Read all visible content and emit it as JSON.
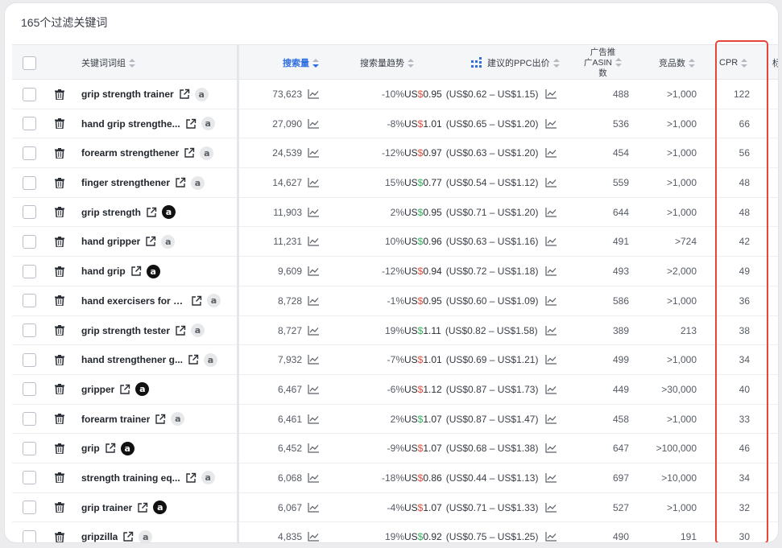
{
  "header": {
    "title": "165个过滤关键词"
  },
  "columns": {
    "keyword_group": "关键词词组",
    "search_volume": "搜索量",
    "search_trend": "搜索量趋势",
    "ppc_bid": "建议的PPC出价",
    "ad_asin_l1": "广告推",
    "ad_asin_l2": "广ASIN",
    "ad_asin_l3": "数",
    "competitors": "竞品数",
    "cpr": "CPR",
    "extra": "标"
  },
  "colors": {
    "accent": "#2f6fe0",
    "highlight": "#e8453a"
  },
  "rows": [
    {
      "keyword": "grip strength trainer",
      "volume": "73,623",
      "trend": "-10%",
      "bid": "US$0.95",
      "range": "(US$0.62 – US$1.15)",
      "asin": "488",
      "comp": ">1,000",
      "cpr": "122",
      "amz": "light",
      "dollar": "red"
    },
    {
      "keyword": "hand grip strengthe...",
      "volume": "27,090",
      "trend": "-8%",
      "bid": "US$1.01",
      "range": "(US$0.65 – US$1.20)",
      "asin": "536",
      "comp": ">1,000",
      "cpr": "66",
      "amz": "light",
      "dollar": "red"
    },
    {
      "keyword": "forearm strengthener",
      "volume": "24,539",
      "trend": "-12%",
      "bid": "US$0.97",
      "range": "(US$0.63 – US$1.20)",
      "asin": "454",
      "comp": ">1,000",
      "cpr": "56",
      "amz": "light",
      "dollar": "red"
    },
    {
      "keyword": "finger strengthener",
      "volume": "14,627",
      "trend": "15%",
      "bid": "US$0.77",
      "range": "(US$0.54 – US$1.12)",
      "asin": "559",
      "comp": ">1,000",
      "cpr": "48",
      "amz": "light",
      "dollar": "green"
    },
    {
      "keyword": "grip strength",
      "volume": "11,903",
      "trend": "2%",
      "bid": "US$0.95",
      "range": "(US$0.71 – US$1.20)",
      "asin": "644",
      "comp": ">1,000",
      "cpr": "48",
      "amz": "dark",
      "dollar": "green"
    },
    {
      "keyword": "hand gripper",
      "volume": "11,231",
      "trend": "10%",
      "bid": "US$0.96",
      "range": "(US$0.63 – US$1.16)",
      "asin": "491",
      "comp": ">724",
      "cpr": "42",
      "amz": "light",
      "dollar": "green"
    },
    {
      "keyword": "hand grip",
      "volume": "9,609",
      "trend": "-12%",
      "bid": "US$0.94",
      "range": "(US$0.72 – US$1.18)",
      "asin": "493",
      "comp": ">2,000",
      "cpr": "49",
      "amz": "dark",
      "dollar": "red"
    },
    {
      "keyword": "hand exercisers for s...",
      "volume": "8,728",
      "trend": "-1%",
      "bid": "US$0.95",
      "range": "(US$0.60 – US$1.09)",
      "asin": "586",
      "comp": ">1,000",
      "cpr": "36",
      "amz": "light",
      "dollar": "red"
    },
    {
      "keyword": "grip strength tester",
      "volume": "8,727",
      "trend": "19%",
      "bid": "US$1.11",
      "range": "(US$0.82 – US$1.58)",
      "asin": "389",
      "comp": "213",
      "cpr": "38",
      "amz": "light",
      "dollar": "green"
    },
    {
      "keyword": "hand strengthener g...",
      "volume": "7,932",
      "trend": "-7%",
      "bid": "US$1.01",
      "range": "(US$0.69 – US$1.21)",
      "asin": "499",
      "comp": ">1,000",
      "cpr": "34",
      "amz": "light",
      "dollar": "red"
    },
    {
      "keyword": "gripper",
      "volume": "6,467",
      "trend": "-6%",
      "bid": "US$1.12",
      "range": "(US$0.87 – US$1.73)",
      "asin": "449",
      "comp": ">30,000",
      "cpr": "40",
      "amz": "dark",
      "dollar": "red"
    },
    {
      "keyword": "forearm trainer",
      "volume": "6,461",
      "trend": "2%",
      "bid": "US$1.07",
      "range": "(US$0.87 – US$1.47)",
      "asin": "458",
      "comp": ">1,000",
      "cpr": "33",
      "amz": "light",
      "dollar": "green"
    },
    {
      "keyword": "grip",
      "volume": "6,452",
      "trend": "-9%",
      "bid": "US$1.07",
      "range": "(US$0.68 – US$1.38)",
      "asin": "647",
      "comp": ">100,000",
      "cpr": "46",
      "amz": "dark",
      "dollar": "red"
    },
    {
      "keyword": "strength training eq...",
      "volume": "6,068",
      "trend": "-18%",
      "bid": "US$0.86",
      "range": "(US$0.44 – US$1.13)",
      "asin": "697",
      "comp": ">10,000",
      "cpr": "34",
      "amz": "light",
      "dollar": "red"
    },
    {
      "keyword": "grip trainer",
      "volume": "6,067",
      "trend": "-4%",
      "bid": "US$1.07",
      "range": "(US$0.71 – US$1.33)",
      "asin": "527",
      "comp": ">1,000",
      "cpr": "32",
      "amz": "dark",
      "dollar": "red"
    },
    {
      "keyword": "gripzilla",
      "volume": "4,835",
      "trend": "19%",
      "bid": "US$0.92",
      "range": "(US$0.75 – US$1.25)",
      "asin": "490",
      "comp": "191",
      "cpr": "30",
      "amz": "light",
      "dollar": "green"
    }
  ]
}
